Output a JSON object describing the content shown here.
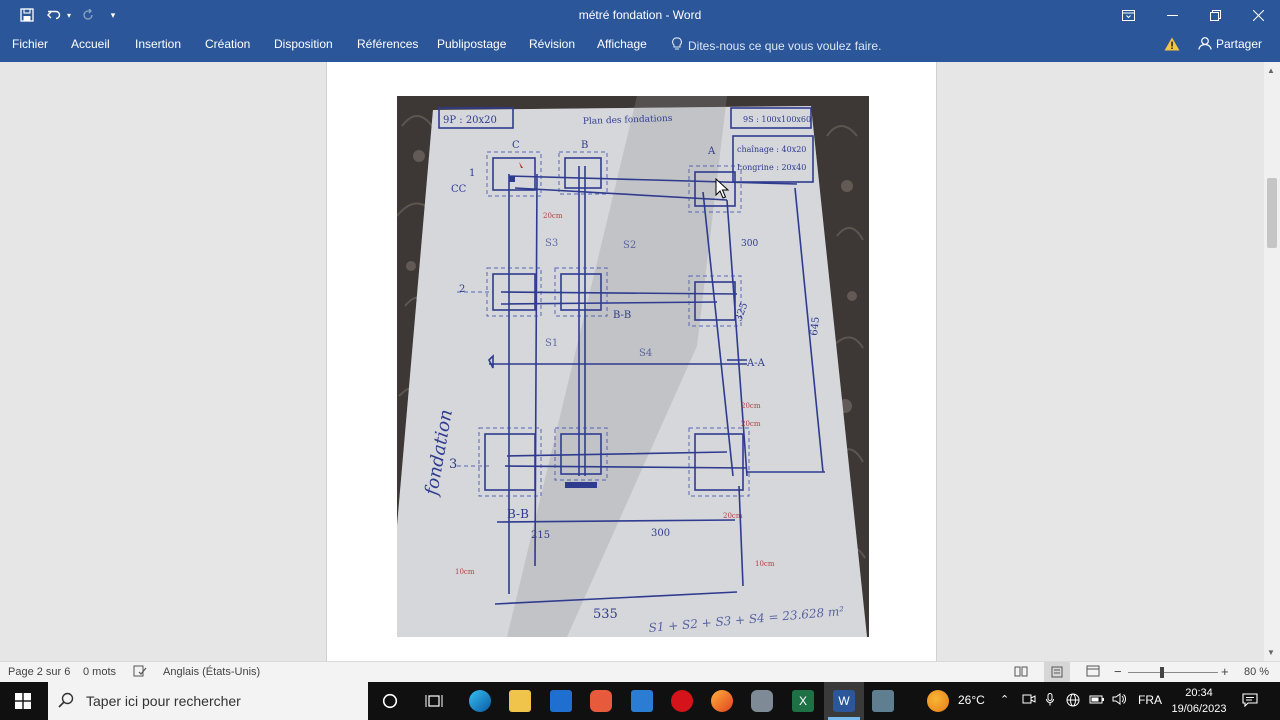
{
  "window": {
    "title": "métré fondation - Word"
  },
  "ribbon": {
    "tabs": [
      "Fichier",
      "Accueil",
      "Insertion",
      "Création",
      "Disposition",
      "Références",
      "Publipostage",
      "Révision",
      "Affichage"
    ],
    "tell_me": "Dites-nous ce que vous voulez faire.",
    "share_label": "Partager"
  },
  "document": {
    "sketch": {
      "labels": {
        "top_left": "9P : 20x20",
        "top_center": "Plan des fondations",
        "top_right": "9S : 100x100x60",
        "chainage": "chaînage : 40x20",
        "longrine": "Longrine : 20x40",
        "cc": "CC",
        "axis_c": "C",
        "axis_b": "B",
        "axis_a": "A",
        "row_1": "1",
        "row_2": "2",
        "row_3": "3",
        "section_bb_top": "B-B",
        "section_aa": "A-A",
        "section_bb": "B-B",
        "s1": "S1",
        "s2": "S2",
        "s3": "S3",
        "s4": "S4",
        "dim_300_right": "300",
        "dim_325": "325",
        "dim_645": "645",
        "dim_215": "215",
        "dim_300_bottom": "300",
        "dim_535": "535",
        "cm_10_left": "10cm",
        "cm_10_right": "10cm",
        "cm_20_a": "20cm",
        "cm_20_b": "20cm",
        "cm_20_c": "20cm",
        "cm_20_d": "20cm",
        "fondation": "fondation",
        "formula": "S1 + S2 + S3 + S4 = 23.628 m²"
      }
    }
  },
  "statusbar": {
    "page": "Page 2 sur 6",
    "words": "0 mots",
    "language": "Anglais (États-Unis)",
    "zoom": "80 %"
  },
  "taskbar": {
    "search_placeholder": "Taper ici pour rechercher",
    "temperature": "26°C",
    "language": "FRA",
    "time": "20:34",
    "date": "19/06/2023"
  },
  "colors": {
    "word_blue": "#2b579a",
    "ink_blue": "#2f3b8f",
    "ink_red": "#b03030"
  }
}
